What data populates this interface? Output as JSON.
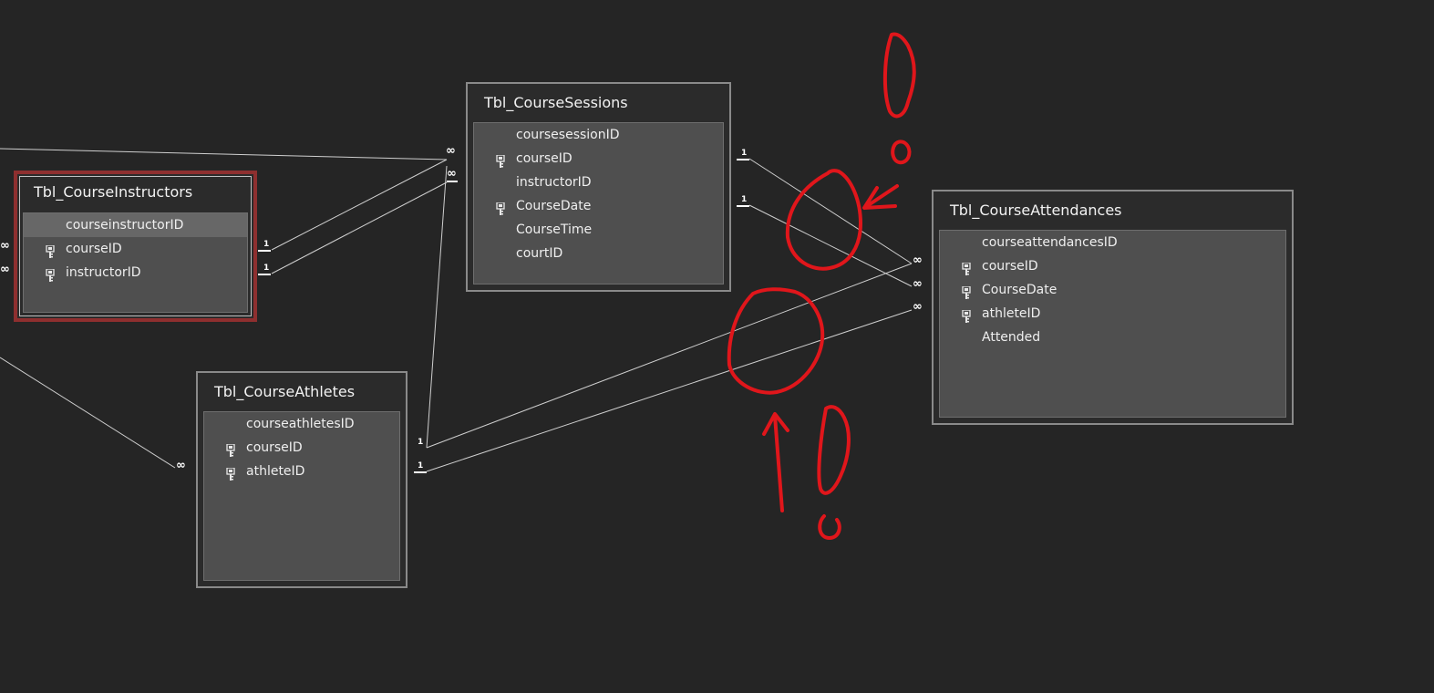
{
  "tables": {
    "course_sessions": {
      "title": "Tbl_CourseSessions",
      "fields": [
        {
          "name": "coursesessionID",
          "key": false
        },
        {
          "name": "courseID",
          "key": true
        },
        {
          "name": "instructorID",
          "key": false
        },
        {
          "name": "CourseDate",
          "key": true
        },
        {
          "name": "CourseTime",
          "key": false
        },
        {
          "name": "courtID",
          "key": false
        }
      ]
    },
    "course_instructors": {
      "title": "Tbl_CourseInstructors",
      "fields": [
        {
          "name": "courseinstructorID",
          "key": false
        },
        {
          "name": "courseID",
          "key": true
        },
        {
          "name": "instructorID",
          "key": true
        }
      ]
    },
    "course_athletes": {
      "title": "Tbl_CourseAthletes",
      "fields": [
        {
          "name": "courseathletesID",
          "key": false
        },
        {
          "name": "courseID",
          "key": true
        },
        {
          "name": "athleteID",
          "key": true
        }
      ]
    },
    "course_attendances": {
      "title": "Tbl_CourseAttendances",
      "fields": [
        {
          "name": "courseattendancesID",
          "key": false
        },
        {
          "name": "courseID",
          "key": true
        },
        {
          "name": "CourseDate",
          "key": true
        },
        {
          "name": "athleteID",
          "key": true
        },
        {
          "name": "Attended",
          "key": false
        }
      ]
    }
  },
  "cardinality": {
    "one": "1",
    "many": "∞"
  },
  "colors": {
    "background": "#252525",
    "line": "#d0d0d0",
    "annotation": "#e0161b",
    "selected_border": "#8e2f2f"
  }
}
